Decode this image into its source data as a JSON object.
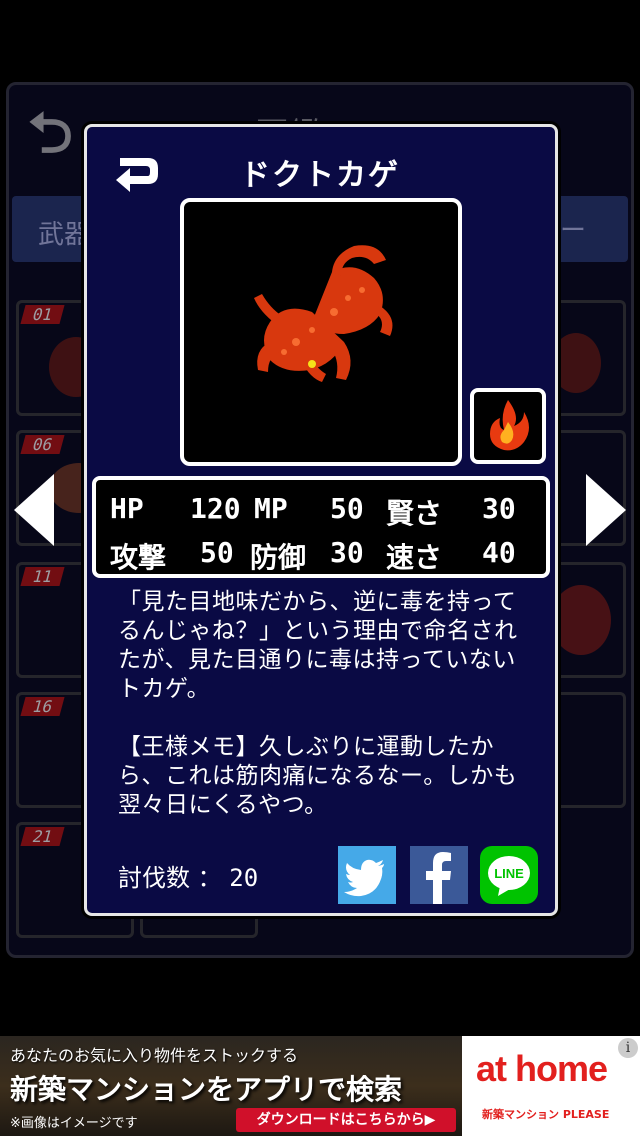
{
  "background": {
    "title": "図鑑",
    "tab_left": "武器",
    "tab_right": "ー",
    "cells": [
      {
        "num": "01"
      },
      {
        "num": "06"
      },
      {
        "num": "11"
      },
      {
        "num": "16"
      },
      {
        "num": "21"
      }
    ]
  },
  "monster": {
    "name": "ドクトカゲ",
    "element_icon": "fire-icon",
    "stats": {
      "hp_label": "HP",
      "hp": "120",
      "mp_label": "MP",
      "mp": "50",
      "def_label": "賢さ",
      "def": "30",
      "atk_label": "攻撃",
      "atk": "50",
      "guard_label": "防御",
      "guard": "30",
      "spd_label": "速さ",
      "spd": "40"
    },
    "description": "「見た目地味だから、逆に毒を持ってるんじゃね？」という理由で命名されたが、見た目通りに毒は持っていないトカゲ。",
    "memo": "【王様メモ】久しぶりに運動したから、これは筋肉痛になるなー。しかも翌々日にくるやつ。",
    "kills_label": "討伐数 ：",
    "kills": "20"
  },
  "share": {
    "twitter": "twitter-icon",
    "facebook": "facebook-icon",
    "line": "LINE"
  },
  "ad": {
    "line1": "あなたのお気に入り物件をストックする",
    "line2": "新築マンションをアプリで検索",
    "note": "※画像はイメージです",
    "cta": "ダウンロードはこちらから▶",
    "logo": "at home",
    "sub": "新築マンション PLEASE",
    "info": "i"
  },
  "colors": {
    "modal_bg": "#0a0a44",
    "fire": "#e83a10",
    "twitter": "#45a9e8",
    "facebook": "#3b5998",
    "line": "#00c300",
    "ad_red": "#e2201e"
  }
}
